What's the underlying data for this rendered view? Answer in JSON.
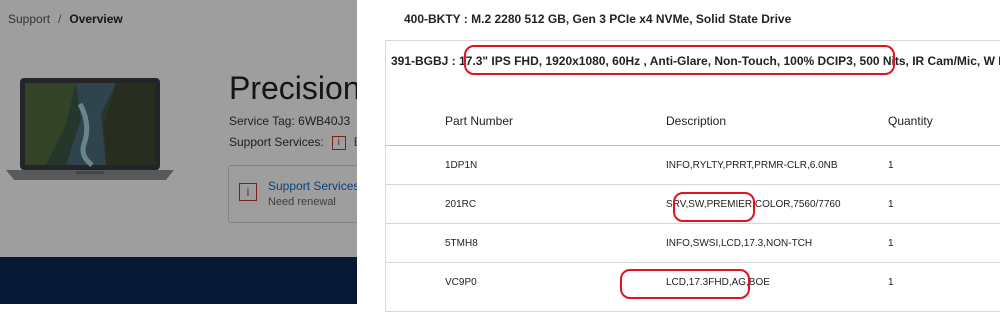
{
  "background": {
    "breadcrumb": {
      "support": "Support",
      "separator": "/",
      "overview": "Overview"
    },
    "product_title": "Precision",
    "service_tag": "Service Tag: 6WB40J3",
    "support_services_label": "Support Services:",
    "support_services_link": "B",
    "card": {
      "title": "Support Services",
      "subtitle": "Need renewal"
    }
  },
  "panel": {
    "line_top": "400-BKTY : M.2 2280 512 GB, Gen 3 PCIe x4 NVMe, Solid State Drive",
    "line_code": "391-BGBJ : ",
    "line_desc": "17.3\" IPS FHD, 1920x1080, 60Hz , Anti-Glare, Non-Touch, 100% DCIP3, 500 Nits,",
    "line_rest": " IR Cam/Mic, W LAN",
    "table": {
      "headers": [
        "Part Number",
        "Description",
        "Quantity"
      ],
      "rows": [
        {
          "part": "1DP1N",
          "desc": "INFO,RYLTY,PRRT,PRMR-CLR,6.0NB",
          "qty": "1"
        },
        {
          "part": "201RC",
          "desc": "SRV,SW,PREMIER,COLOR,7560/7760",
          "qty": "1"
        },
        {
          "part": "5TMH8",
          "desc": "INFO,SWSI,LCD,17.3,NON-TCH",
          "qty": "1"
        },
        {
          "part": "VC9P0",
          "desc": "LCD,17.3FHD,AG,BOE",
          "qty": "1"
        }
      ]
    }
  },
  "colors": {
    "annotation_red": "#e0141e",
    "link_blue": "#0b6bcb",
    "footer_navy": "#0b2a57"
  }
}
